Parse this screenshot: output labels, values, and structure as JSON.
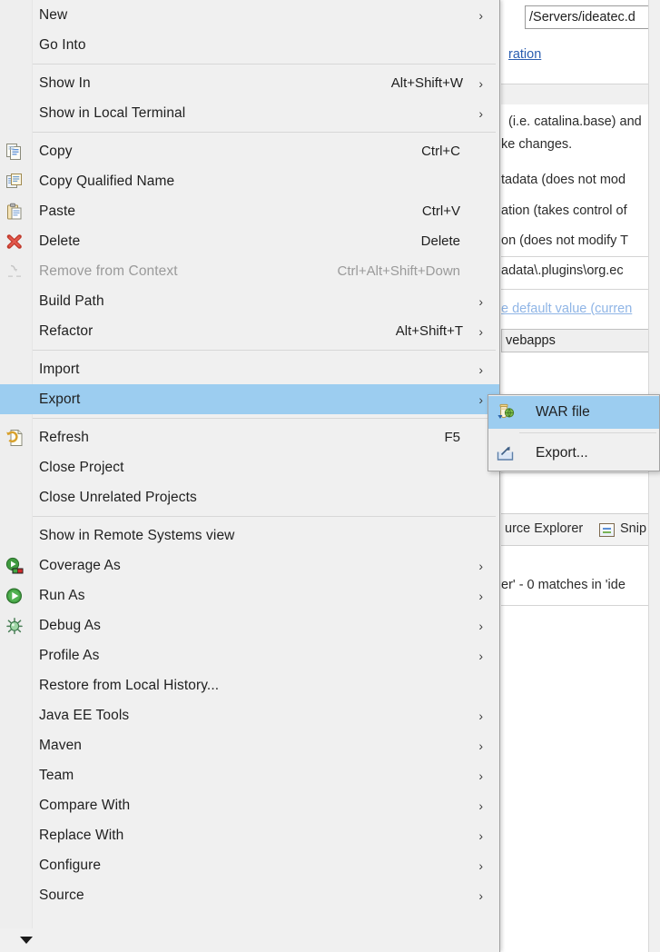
{
  "window": {
    "app": "Eclipse IDE",
    "accent_selection": "#9ccdf0",
    "menu_background": "#f0f0f0"
  },
  "background": {
    "path_field_value": "/Servers/ideatec.d",
    "link_configuration": "ration",
    "lines": [
      "(i.e. catalina.base) and",
      "ke changes.",
      "tadata (does not mod",
      "ation (takes control of",
      "on (does not modify T",
      "adata\\.plugins\\org.ec"
    ],
    "pale_link": "e default value (curren",
    "webapps_field": "vebapps",
    "tabs": [
      {
        "label": "urce Explorer",
        "icon": "none"
      },
      {
        "label": "Snip",
        "icon": "snippets-icon"
      }
    ],
    "status_line": "er' - 0 matches in 'ide"
  },
  "context_menu": {
    "name": "project-context-menu",
    "scroll_down_glyph": "▼",
    "items": [
      {
        "label": "New",
        "accel": "",
        "arrow": true,
        "icon": "none",
        "disabled": false
      },
      {
        "label": "Go Into",
        "accel": "",
        "arrow": false,
        "icon": "none",
        "disabled": false
      },
      {
        "separator": true
      },
      {
        "label": "Show In",
        "accel": "Alt+Shift+W",
        "arrow": true,
        "icon": "none",
        "disabled": false
      },
      {
        "label": "Show in Local Terminal",
        "accel": "",
        "arrow": true,
        "icon": "none",
        "disabled": false
      },
      {
        "separator": true
      },
      {
        "label": "Copy",
        "accel": "Ctrl+C",
        "arrow": false,
        "icon": "copy-icon",
        "disabled": false
      },
      {
        "label": "Copy Qualified Name",
        "accel": "",
        "arrow": false,
        "icon": "copy-qualified-icon",
        "disabled": false
      },
      {
        "label": "Paste",
        "accel": "Ctrl+V",
        "arrow": false,
        "icon": "paste-icon",
        "disabled": false
      },
      {
        "label": "Delete",
        "accel": "Delete",
        "arrow": false,
        "icon": "delete-icon",
        "disabled": false
      },
      {
        "label": "Remove from Context",
        "accel": "Ctrl+Alt+Shift+Down",
        "arrow": false,
        "icon": "remove-context-icon",
        "disabled": true
      },
      {
        "label": "Build Path",
        "accel": "",
        "arrow": true,
        "icon": "none",
        "disabled": false
      },
      {
        "label": "Refactor",
        "accel": "Alt+Shift+T",
        "arrow": true,
        "icon": "none",
        "disabled": false
      },
      {
        "separator": true
      },
      {
        "label": "Import",
        "accel": "",
        "arrow": true,
        "icon": "none",
        "disabled": false
      },
      {
        "label": "Export",
        "accel": "",
        "arrow": true,
        "icon": "none",
        "disabled": false,
        "selected": true
      },
      {
        "separator": true
      },
      {
        "label": "Refresh",
        "accel": "F5",
        "arrow": false,
        "icon": "refresh-icon",
        "disabled": false
      },
      {
        "label": "Close Project",
        "accel": "",
        "arrow": false,
        "icon": "none",
        "disabled": false
      },
      {
        "label": "Close Unrelated Projects",
        "accel": "",
        "arrow": false,
        "icon": "none",
        "disabled": false
      },
      {
        "separator": true
      },
      {
        "label": "Show in Remote Systems view",
        "accel": "",
        "arrow": false,
        "icon": "none",
        "disabled": false
      },
      {
        "label": "Coverage As",
        "accel": "",
        "arrow": true,
        "icon": "coverage-icon",
        "disabled": false
      },
      {
        "label": "Run As",
        "accel": "",
        "arrow": true,
        "icon": "run-icon",
        "disabled": false
      },
      {
        "label": "Debug As",
        "accel": "",
        "arrow": true,
        "icon": "debug-icon",
        "disabled": false
      },
      {
        "label": "Profile As",
        "accel": "",
        "arrow": true,
        "icon": "none",
        "disabled": false
      },
      {
        "label": "Restore from Local History...",
        "accel": "",
        "arrow": false,
        "icon": "none",
        "disabled": false
      },
      {
        "label": "Java EE Tools",
        "accel": "",
        "arrow": true,
        "icon": "none",
        "disabled": false
      },
      {
        "label": "Maven",
        "accel": "",
        "arrow": true,
        "icon": "none",
        "disabled": false
      },
      {
        "label": "Team",
        "accel": "",
        "arrow": true,
        "icon": "none",
        "disabled": false
      },
      {
        "label": "Compare With",
        "accel": "",
        "arrow": true,
        "icon": "none",
        "disabled": false
      },
      {
        "label": "Replace With",
        "accel": "",
        "arrow": true,
        "icon": "none",
        "disabled": false
      },
      {
        "label": "Configure",
        "accel": "",
        "arrow": true,
        "icon": "none",
        "disabled": false
      },
      {
        "label": "Source",
        "accel": "",
        "arrow": true,
        "icon": "none",
        "disabled": false
      }
    ]
  },
  "submenu": {
    "name": "export-submenu",
    "items": [
      {
        "label": "WAR file",
        "icon": "war-file-icon",
        "selected": true
      },
      {
        "separator": true
      },
      {
        "label": "Export...",
        "icon": "export-wizard-icon",
        "selected": false
      }
    ]
  },
  "arrow_glyph": "›"
}
